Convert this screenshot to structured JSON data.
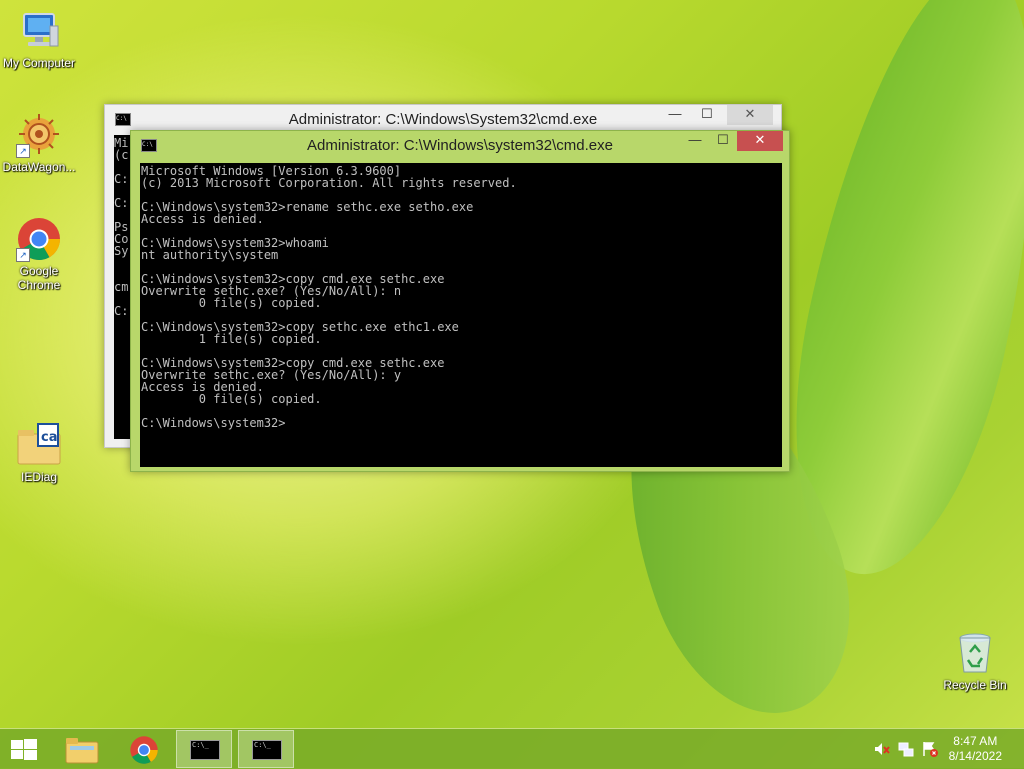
{
  "desktop": {
    "icons": [
      {
        "label": "My Computer"
      },
      {
        "label": "DataWagon..."
      },
      {
        "label": "Google Chrome"
      },
      {
        "label": "IEDiag"
      },
      {
        "label": "Recycle Bin"
      }
    ]
  },
  "back_window": {
    "title": "Administrator: C:\\Windows\\System32\\cmd.exe",
    "console_lines": "Mi\n(c\n\nC:\n\nC:\n\nPs\nCo\nSy\n\n\ncm\n\nC:",
    "minimize": "—",
    "maximize": "☐",
    "close": "✕"
  },
  "front_window": {
    "title": "Administrator: C:\\Windows\\system32\\cmd.exe",
    "console_lines": "Microsoft Windows [Version 6.3.9600]\n(c) 2013 Microsoft Corporation. All rights reserved.\n\nC:\\Windows\\system32>rename sethc.exe setho.exe\nAccess is denied.\n\nC:\\Windows\\system32>whoami\nnt authority\\system\n\nC:\\Windows\\system32>copy cmd.exe sethc.exe\nOverwrite sethc.exe? (Yes/No/All): n\n        0 file(s) copied.\n\nC:\\Windows\\system32>copy sethc.exe ethc1.exe\n        1 file(s) copied.\n\nC:\\Windows\\system32>copy cmd.exe sethc.exe\nOverwrite sethc.exe? (Yes/No/All): y\nAccess is denied.\n        0 file(s) copied.\n\nC:\\Windows\\system32>",
    "minimize": "—",
    "maximize": "☐",
    "close": "✕"
  },
  "taskbar": {
    "cmd_icon_text": "C:\\_",
    "clock_time": "8:47 AM",
    "clock_date": "8/14/2022"
  }
}
